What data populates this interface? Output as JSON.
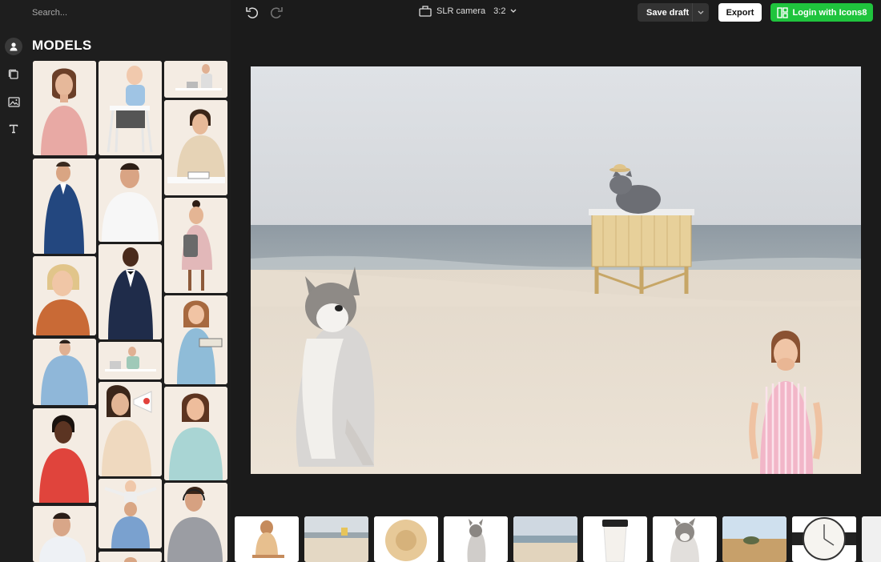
{
  "search": {
    "placeholder": "Search..."
  },
  "sidebar": {
    "title": "MODELS",
    "rail_icons": [
      "user-icon",
      "layers-icon",
      "image-icon",
      "text-icon"
    ]
  },
  "toolbar": {
    "camera_label": "SLR camera",
    "aspect_ratio": "3:2",
    "save_label": "Save draft",
    "export_label": "Export",
    "login_label": "Login with Icons8"
  },
  "colors": {
    "background": "#1b1b1b",
    "panel": "#1e1e1e",
    "accent_green": "#1fc43d",
    "tile_bg": "#f3ece4"
  }
}
